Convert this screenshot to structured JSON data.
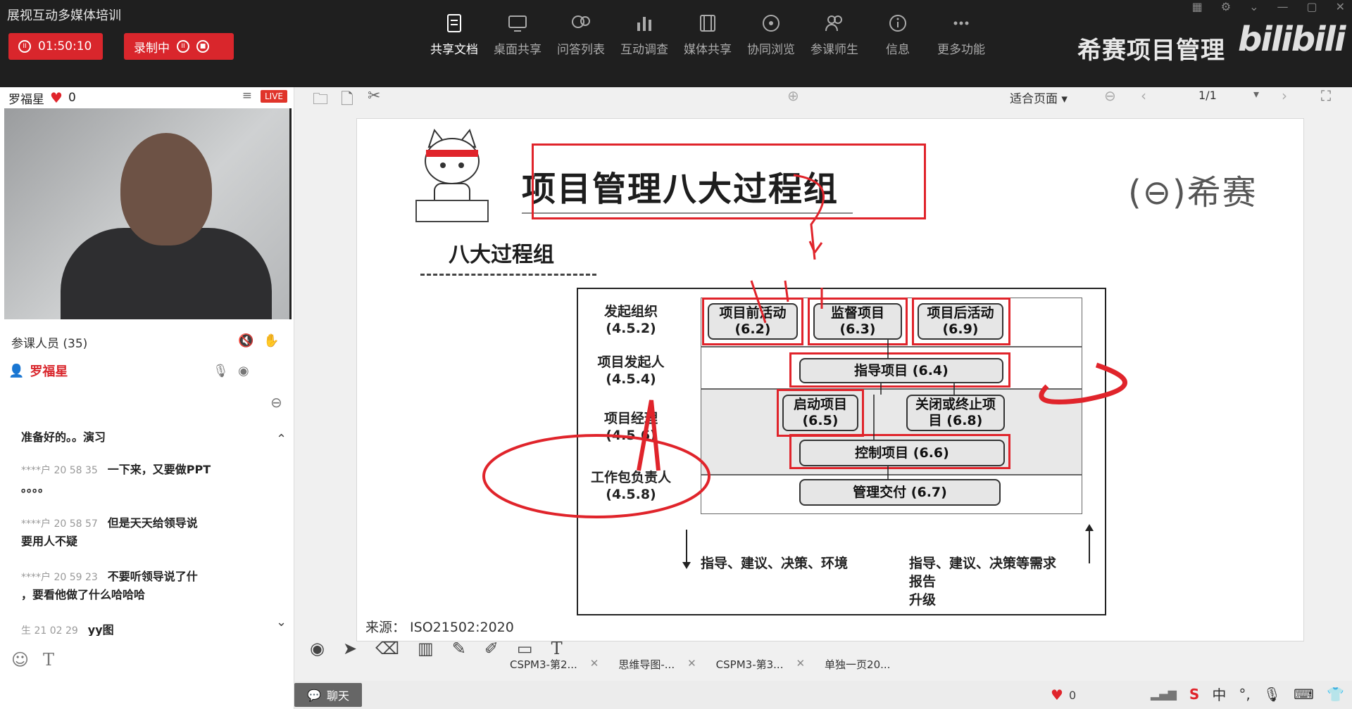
{
  "app_title": "展视互动多媒体培训",
  "timer": "01:50:10",
  "recording_label": "录制中",
  "toolbar": [
    {
      "label": "共享文档",
      "icon": "document-share-icon",
      "active": true
    },
    {
      "label": "桌面共享",
      "icon": "desktop-share-icon",
      "active": false
    },
    {
      "label": "问答列表",
      "icon": "qa-list-icon",
      "active": false
    },
    {
      "label": "互动调查",
      "icon": "survey-chart-icon",
      "active": false
    },
    {
      "label": "媒体共享",
      "icon": "media-film-icon",
      "active": false
    },
    {
      "label": "协同浏览",
      "icon": "compass-icon",
      "active": false
    },
    {
      "label": "参课师生",
      "icon": "people-icon",
      "active": false
    },
    {
      "label": "信息",
      "icon": "info-icon",
      "active": false
    },
    {
      "label": "更多功能",
      "icon": "more-dots-icon",
      "active": false
    }
  ],
  "brand_text": "希赛项目管理",
  "bili_text": "bilibili",
  "presenter": {
    "name": "罗福星",
    "likes": "0",
    "live": "LIVE"
  },
  "participants_label": "参课人员 (35)",
  "self_name": "罗福星",
  "chat": [
    {
      "meta": "",
      "text": "准备好的。。演习"
    },
    {
      "meta": "****户 20 58 35",
      "text": "一下来，又要做PPT"
    },
    {
      "meta": "",
      "text": "。。。。"
    },
    {
      "meta": "****户 20 58 57",
      "text": "但是天天给领导说"
    },
    {
      "meta": "",
      "text": "要用人不疑"
    },
    {
      "meta": "****户 20 59 23",
      "text": "不要听领导说了什"
    },
    {
      "meta": "",
      "text": "，要看他做了什么哈哈哈"
    },
    {
      "meta": "生 21 02 29",
      "text": "yy图"
    }
  ],
  "doc": {
    "fit_label": "适合页面",
    "page": "1/1"
  },
  "slide": {
    "title": "项目管理八大过程组",
    "subtitle": "八大过程组",
    "logo": "希赛",
    "source": "来源： ISO21502:2020",
    "rows": [
      {
        "label": "发起组织\n(4.5.2)"
      },
      {
        "label": "项目发起人\n(4.5.4)"
      },
      {
        "label": "项目经理\n(4.5.6)"
      },
      {
        "label": "工作包负责人\n(4.5.8)"
      }
    ],
    "boxes": {
      "pre": "项目前活动\n(6.2)",
      "monitor": "监督项目\n(6.3)",
      "post": "项目后活动\n(6.9)",
      "direct": "指导项目 (6.4)",
      "start": "启动项目\n(6.5)",
      "close": "关闭或终止项\n目 (6.8)",
      "control": "控制项目 (6.6)",
      "deliver": "管理交付 (6.7)"
    },
    "bottom_left": "指导、建议、决策、环境",
    "bottom_right_1": "指导、建议、决策等需求",
    "bottom_right_2": "报告",
    "bottom_right_3": "升级"
  },
  "doc_tabs": [
    "CSPM3-第2...",
    "思维导图-...",
    "CSPM3-第3...",
    "单独一页20..."
  ],
  "chat_button": "聊天",
  "footer_likes": "0",
  "ime_label": "中",
  "colors": {
    "accent_red": "#d9262c",
    "annotation_red": "#e0242b",
    "topbar": "#1f1f1f"
  }
}
